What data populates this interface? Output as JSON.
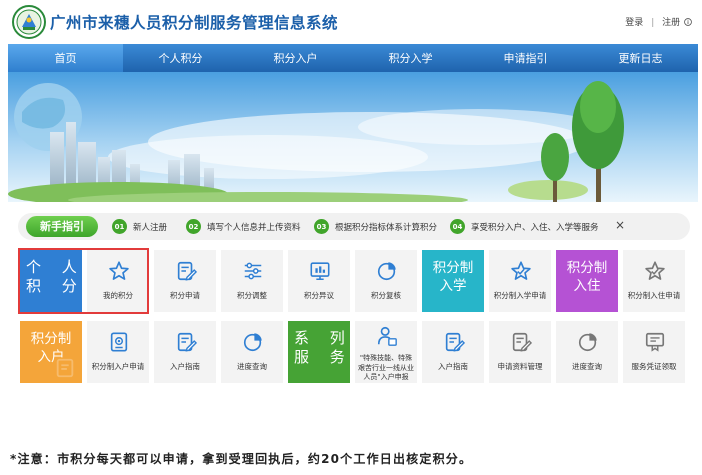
{
  "header": {
    "title": "广州市来穗人员积分制服务管理信息系统",
    "login": "登录",
    "register": "注册",
    "separator": "|",
    "logo_icon": "emblem-icon"
  },
  "nav": {
    "items": [
      "首页",
      "个人积分",
      "积分入户",
      "积分入学",
      "申请指引",
      "更新日志"
    ],
    "active_index": 0
  },
  "guide": {
    "badge": "新手指引",
    "steps": [
      {
        "num": "01",
        "text": "新人注册"
      },
      {
        "num": "02",
        "text": "填写个人信息并上传资料"
      },
      {
        "num": "03",
        "text": "根据积分指标体系计算积分"
      },
      {
        "num": "04",
        "text": "享受积分入户、入住、入学等服务"
      }
    ],
    "close": "×"
  },
  "tiles": {
    "row1": [
      {
        "type": "big",
        "label": "个 人\n积 分",
        "color": "#2f7fd3"
      },
      {
        "type": "icon",
        "label": "我的积分",
        "icon": "star-outline-icon"
      },
      {
        "type": "icon",
        "label": "积分申请",
        "icon": "edit-document-icon"
      },
      {
        "type": "icon",
        "label": "积分调整",
        "icon": "sliders-icon"
      },
      {
        "type": "icon",
        "label": "积分异议",
        "icon": "monitor-chart-icon"
      },
      {
        "type": "icon",
        "label": "积分复核",
        "icon": "pie-chart-icon"
      },
      {
        "type": "big",
        "label": "积分制\n入学",
        "color": "#27b5c9"
      },
      {
        "type": "icon",
        "label": "积分制入学申请",
        "icon": "star-check-icon"
      },
      {
        "type": "big",
        "label": "积分制\n入住",
        "color": "#b552d4"
      },
      {
        "type": "icon",
        "label": "积分制入住申请",
        "icon": "star-check-gray-icon"
      }
    ],
    "row2": [
      {
        "type": "big",
        "label": "积分制\n入户",
        "color": "#f4a53a"
      },
      {
        "type": "icon",
        "label": "积分制入户申请",
        "icon": "document-badge-icon"
      },
      {
        "type": "icon",
        "label": "入户指南",
        "icon": "edit-document-icon"
      },
      {
        "type": "icon",
        "label": "进度查询",
        "icon": "pie-chart-icon"
      },
      {
        "type": "big",
        "label": "系 列\n服 务",
        "color": "#46a335"
      },
      {
        "type": "multi",
        "label": "\"特殊技能、特殊艰苦行业一线从业人员\"入户申报",
        "icon": "person-form-icon"
      },
      {
        "type": "icon",
        "label": "入户指南",
        "icon": "edit-document-icon"
      },
      {
        "type": "icon",
        "label": "申请资料管理",
        "icon": "edit-document-gray-icon"
      },
      {
        "type": "icon",
        "label": "进度查询",
        "icon": "pie-chart-gray-icon"
      },
      {
        "type": "icon",
        "label": "服务凭证领取",
        "icon": "certificate-icon"
      }
    ]
  },
  "footnote": "*注意：市积分每天都可以申请，拿到受理回执后，约20个工作日出核定积分。",
  "colors": {
    "brand_blue": "#1b5fa9",
    "nav_blue": "#2a73c2",
    "guide_green": "#41a52b",
    "highlight_red": "#e23b3b",
    "icon_blue": "#2f7fd3"
  }
}
